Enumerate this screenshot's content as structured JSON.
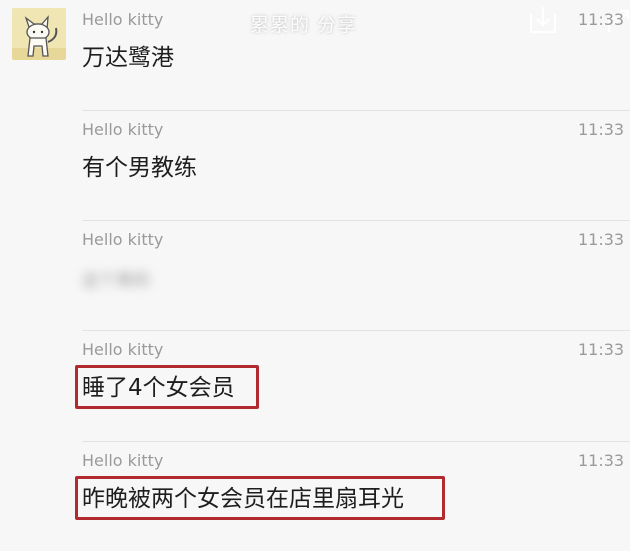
{
  "header": {
    "title": "累累的 分享",
    "download_icon": "download-icon",
    "share_icon": "share-icon"
  },
  "messages": [
    {
      "sender": "Hello kitty",
      "time": "11:33",
      "text": "万达鹭港"
    },
    {
      "sender": "Hello kitty",
      "time": "11:33",
      "text": "有个男教练"
    },
    {
      "sender": "Hello kitty",
      "time": "11:33",
      "text": "这个男的"
    },
    {
      "sender": "Hello kitty",
      "time": "11:33",
      "text": "睡了4个女会员"
    },
    {
      "sender": "Hello kitty",
      "time": "11:33",
      "text": "昨晚被两个女会员在店里扇耳光"
    }
  ],
  "colors": {
    "highlight": "#b02a30",
    "meta_text": "#9a9a9a",
    "background": "#f7f7f7"
  }
}
